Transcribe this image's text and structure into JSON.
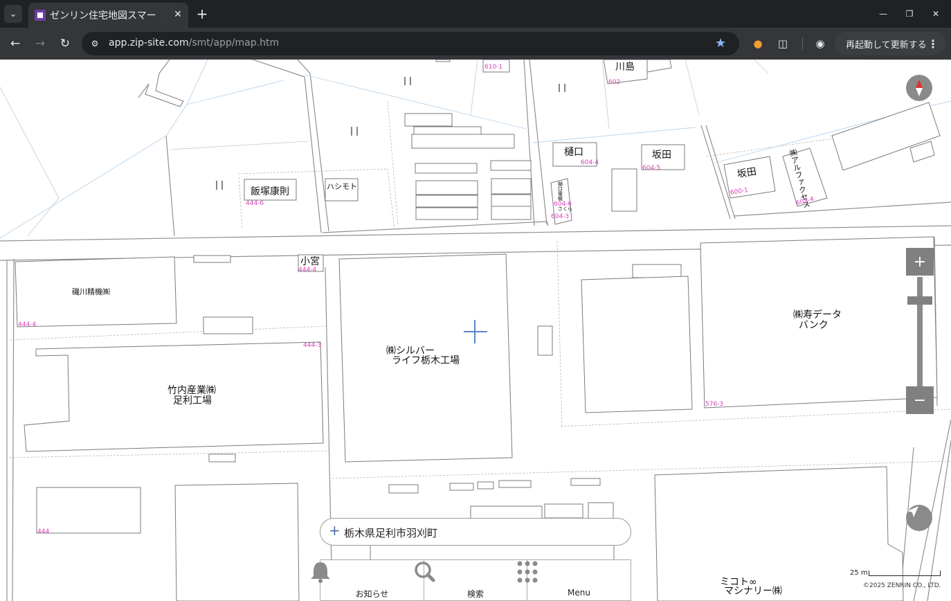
{
  "browser": {
    "tab_title": "ゼンリン住宅地図スマー",
    "url_host": "app.zip-site.com",
    "url_path": "/smt/app/map.htm",
    "update_button": "再起動して更新する",
    "icons": {
      "tab_menu": "chevron-down-icon",
      "close_tab": "close-icon",
      "new_tab": "plus-icon",
      "back": "arrow-left-icon",
      "forward": "arrow-right-icon",
      "reload": "reload-icon",
      "bookmark": "star-icon",
      "extension1": "spy-icon",
      "extension2": "puzzle-icon",
      "profile": "profile-icon",
      "more": "more-vertical-icon"
    }
  },
  "map": {
    "labels": {
      "kawashima": "川島",
      "higuchi": "樋口",
      "sakata1": "坂田",
      "sakata2": "坂田",
      "alfa": "㈱アルファクセス",
      "iizuka": "飯塚康則",
      "hashimoto": "ハシモト",
      "komiya": "小宮",
      "isokawa": "磯川精機㈱",
      "silver_line1": "㈱シルバー",
      "silver_line2": "ライフ栃木工場",
      "kotobuki_line1": "㈱寿データ",
      "kotobuki_line2": "バンク",
      "takeuchi_line1": "竹内産業㈱",
      "takeuchi_line2": "足利工場",
      "mikoto_line1": "ミコト∞",
      "mikoto_line2": "マシナリー㈱",
      "higuchi_small": "樋口電機",
      "sakura_small": "さくら"
    },
    "lots": {
      "l610_1": "610-1",
      "l602": "602",
      "l604_4": "604-4",
      "l604_5": "604-5",
      "l600_1": "600-1",
      "l603_4": "603-4",
      "l444_6": "444-6",
      "l604_3": "604-3",
      "l444_4a": "444-4",
      "l444_4b": "444-4",
      "l444_3": "444-3",
      "l576_3": "576-3",
      "l444": "444",
      "l604_6": "604-6"
    },
    "controls": {
      "zoom_in": "+",
      "zoom_out": "−",
      "compass_icon": "compass-icon",
      "locate_icon": "navigation-icon"
    },
    "search_address": "栃木県足利市羽刈町",
    "bottom_nav": [
      {
        "label": "お知らせ",
        "icon": "bell-icon"
      },
      {
        "label": "検索",
        "icon": "search-icon"
      },
      {
        "label": "Menu",
        "icon": "grid-icon"
      }
    ],
    "scale_label": "25 m",
    "copyright": "©2025 ZENRIN CO., LTD."
  }
}
